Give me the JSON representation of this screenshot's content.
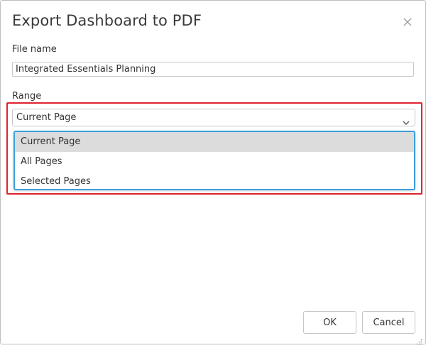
{
  "dialog": {
    "title": "Export Dashboard to PDF",
    "close_icon": "close-icon"
  },
  "file_name": {
    "label": "File name",
    "value": "Integrated Essentials Planning"
  },
  "range": {
    "label": "Range",
    "selected": "Current Page",
    "options": [
      "Current Page",
      "All Pages",
      "Selected Pages"
    ],
    "highlighted_option": "Current Page"
  },
  "buttons": {
    "ok": "OK",
    "cancel": "Cancel"
  },
  "colors": {
    "highlight_border": "#e0232e",
    "dropdown_border": "#3c9ddb",
    "selected_option_bg": "#dcdcdc"
  }
}
